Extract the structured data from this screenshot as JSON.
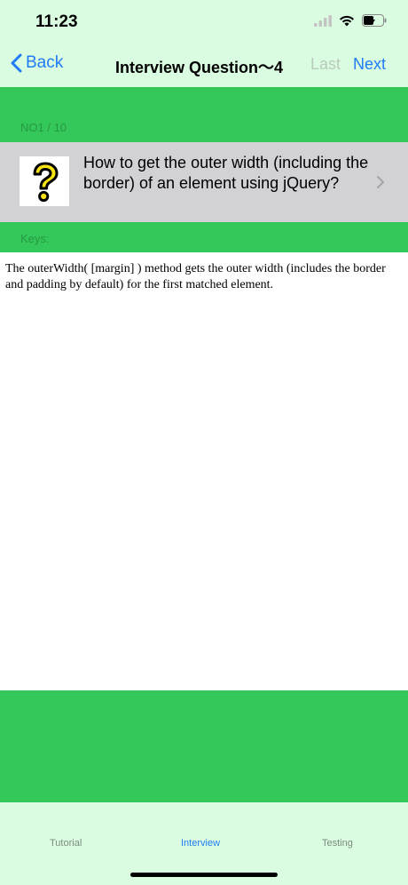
{
  "status": {
    "time": "11:23"
  },
  "nav": {
    "back_label": "Back",
    "title": "Interview Question～4",
    "last_label": "Last",
    "next_label": "Next"
  },
  "question": {
    "index_label": "NO1 / 10",
    "text": "How to get the outer width (including the border) of an element using jQuery?",
    "keys_label": "Keys:"
  },
  "answer": {
    "text": "The outerWidth( [margin] ) method gets the outer width (includes the border and padding by default) for the first matched element."
  },
  "tabs": [
    {
      "label": "Tutorial",
      "active": false
    },
    {
      "label": "Interview",
      "active": true
    },
    {
      "label": "Testing",
      "active": false
    }
  ],
  "colors": {
    "header_bg": "#dafde1",
    "green": "#34c759",
    "accent": "#1f7cf4",
    "row_bg": "#d1d1d6"
  }
}
